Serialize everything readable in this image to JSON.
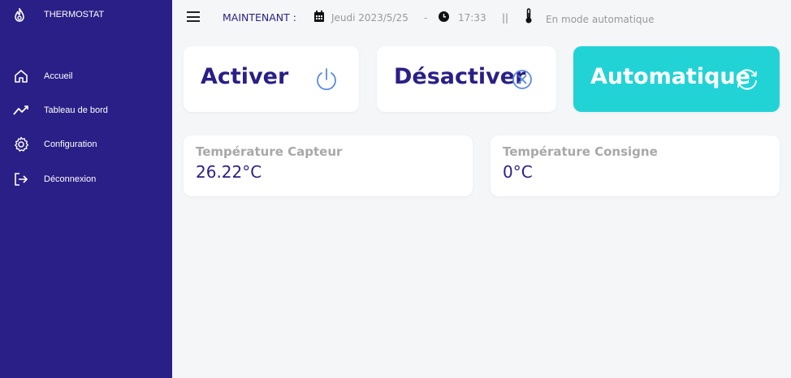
{
  "sidebar": {
    "brand": {
      "icon": "flame-icon",
      "name": "THERMOSTAT"
    },
    "items": [
      {
        "icon": "home-icon",
        "label": "Accueil"
      },
      {
        "icon": "trend-icon",
        "label": "Tableau de bord"
      },
      {
        "icon": "gear-icon",
        "label": "Configuration"
      },
      {
        "icon": "logout-icon",
        "label": "Déconnexion"
      }
    ]
  },
  "topbar": {
    "menu_icon": "hamburger-icon",
    "now_label": "MAINTENANT :",
    "date": "Jeudi 2023/5/25",
    "separator": "-",
    "time": "17:33",
    "divider": "||",
    "mode": "En mode automatique"
  },
  "controls": {
    "activate_label": "Activer",
    "deactivate_label": "Désactiver",
    "auto_label": "Automatique"
  },
  "temperatures": {
    "sensor": {
      "label": "Température Capteur",
      "value": "26.22°C"
    },
    "setpoint": {
      "label": "Température Consigne",
      "value": "0°C"
    }
  },
  "colors": {
    "sidebar": "#2a1f86",
    "accent": "#22d3d6",
    "primary_text": "#2a1f86",
    "muted_text": "#a8a8a8"
  }
}
